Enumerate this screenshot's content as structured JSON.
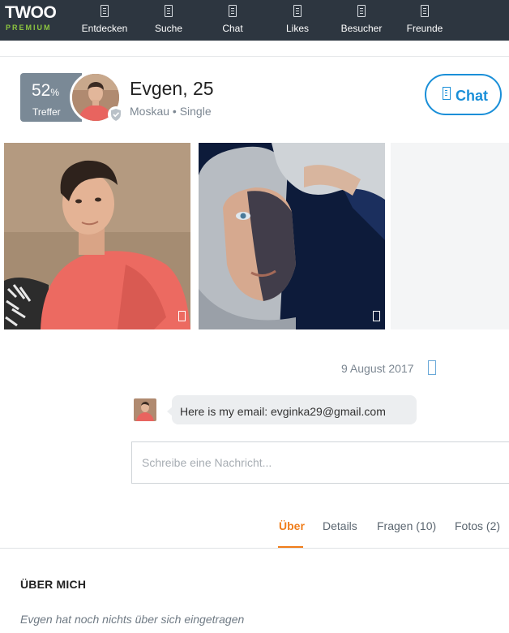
{
  "logo": {
    "main": "TWOO",
    "sub": "PREMIUM"
  },
  "nav": [
    {
      "label": "Entdecken",
      "icon": "discover-icon"
    },
    {
      "label": "Suche",
      "icon": "search-icon"
    },
    {
      "label": "Chat",
      "icon": "chat-icon"
    },
    {
      "label": "Likes",
      "icon": "likes-icon"
    },
    {
      "label": "Besucher",
      "icon": "visitors-icon"
    },
    {
      "label": "Freunde",
      "icon": "friends-icon"
    }
  ],
  "profile": {
    "match_value": "52",
    "match_unit": "%",
    "match_label": "Treffer",
    "name": "Evgen, 25",
    "meta": "Moskau • Single",
    "chat_button": "Chat"
  },
  "conversation": {
    "date": "9 August 2017",
    "message": "Here is my email: evginka29@gmail.com",
    "input_placeholder": "Schreibe eine Nachricht..."
  },
  "tabs": [
    {
      "label": "Über",
      "active": true
    },
    {
      "label": "Details",
      "active": false
    },
    {
      "label": "Fragen (10)",
      "active": false
    },
    {
      "label": "Fotos (2)",
      "active": false
    }
  ],
  "about": {
    "title": "ÜBER MICH",
    "body": "Evgen hat noch nichts über sich eingetragen"
  },
  "colors": {
    "topbar": "#2d3640",
    "accent_blue": "#1a8fd8",
    "accent_orange": "#f07d1a",
    "premium_green": "#8dc63f",
    "badge": "#7a8996"
  }
}
